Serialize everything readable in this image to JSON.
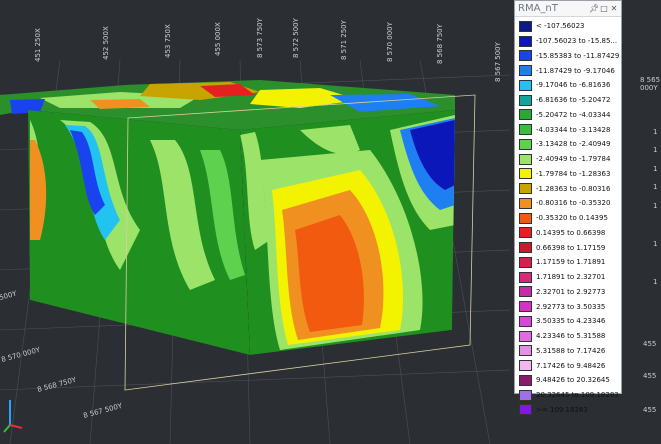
{
  "legend": {
    "title": "RMA_nT",
    "icons": [
      "pin-icon",
      "restore-icon",
      "close-icon"
    ],
    "items": [
      {
        "label": "< -107.56023",
        "color": "#0a1a8a"
      },
      {
        "label": "-107.56023 to -15.85...",
        "color": "#0b17b8"
      },
      {
        "label": "-15.85383 to -11.87429",
        "color": "#1a43f0"
      },
      {
        "label": "-11.87429 to -9.17046",
        "color": "#1e7ff2"
      },
      {
        "label": "-9.17046 to -6.81636",
        "color": "#22c3f0"
      },
      {
        "label": "-6.81636 to -5.20472",
        "color": "#12a49a"
      },
      {
        "label": "-5.20472 to -4.03344",
        "color": "#2aa832"
      },
      {
        "label": "-4.03344 to -3.13428",
        "color": "#3dbd3f"
      },
      {
        "label": "-3.13428 to -2.40949",
        "color": "#5ed24f"
      },
      {
        "label": "-2.40949 to -1.79784",
        "color": "#9ce36a"
      },
      {
        "label": "-1.79784 to -1.28363",
        "color": "#f3f300"
      },
      {
        "label": "-1.28363 to -0.80316",
        "color": "#c8a400"
      },
      {
        "label": "-0.80316 to -0.35320",
        "color": "#f09020"
      },
      {
        "label": "-0.35320 to 0.14395",
        "color": "#f25a10"
      },
      {
        "label": "0.14395 to 0.66398",
        "color": "#e42020"
      },
      {
        "label": "0.66398 to 1.17159",
        "color": "#d0152e"
      },
      {
        "label": "1.17159 to 1.71891",
        "color": "#d81f4c"
      },
      {
        "label": "1.71891 to 2.32701",
        "color": "#d82a78"
      },
      {
        "label": "2.32701 to 2.92773",
        "color": "#c82ca8"
      },
      {
        "label": "2.92773 to 3.50335",
        "color": "#d431c8"
      },
      {
        "label": "3.50335 to 4.23346",
        "color": "#d748d8"
      },
      {
        "label": "4.23346 to 5.31588",
        "color": "#e06ae0"
      },
      {
        "label": "5.31588 to 7.17426",
        "color": "#e48ee4"
      },
      {
        "label": "7.17426 to 9.48426",
        "color": "#f0b8f0"
      },
      {
        "label": "9.48426 to 20.32645",
        "color": "#8a1a6a"
      },
      {
        "label": "20.32645 to 109.18283",
        "color": "#a070e8"
      },
      {
        "label": ">= 109.18283",
        "color": "#8018e0"
      }
    ]
  },
  "axes": {
    "top_labels": [
      "451 250X",
      "452 500X",
      "453 750X",
      "455 000X",
      "8 573 750Y",
      "8 572 500Y",
      "8 571 250Y",
      "8 570 000Y",
      "8 568 750Y",
      "8 567 500Y"
    ],
    "left_labels": [
      "500Y",
      "8 570 000Y",
      "8 568 750Y",
      "8 567 500Y"
    ],
    "right_labels": [
      "8 565 000Y",
      "1",
      "1",
      "1",
      "1",
      "1",
      "1",
      "1",
      "455",
      "455",
      "455"
    ]
  },
  "scene": {
    "background": "#2b2f33",
    "grid_color": "#4a5058",
    "ground": "#8fd27a",
    "green": "#1f8f1f"
  }
}
